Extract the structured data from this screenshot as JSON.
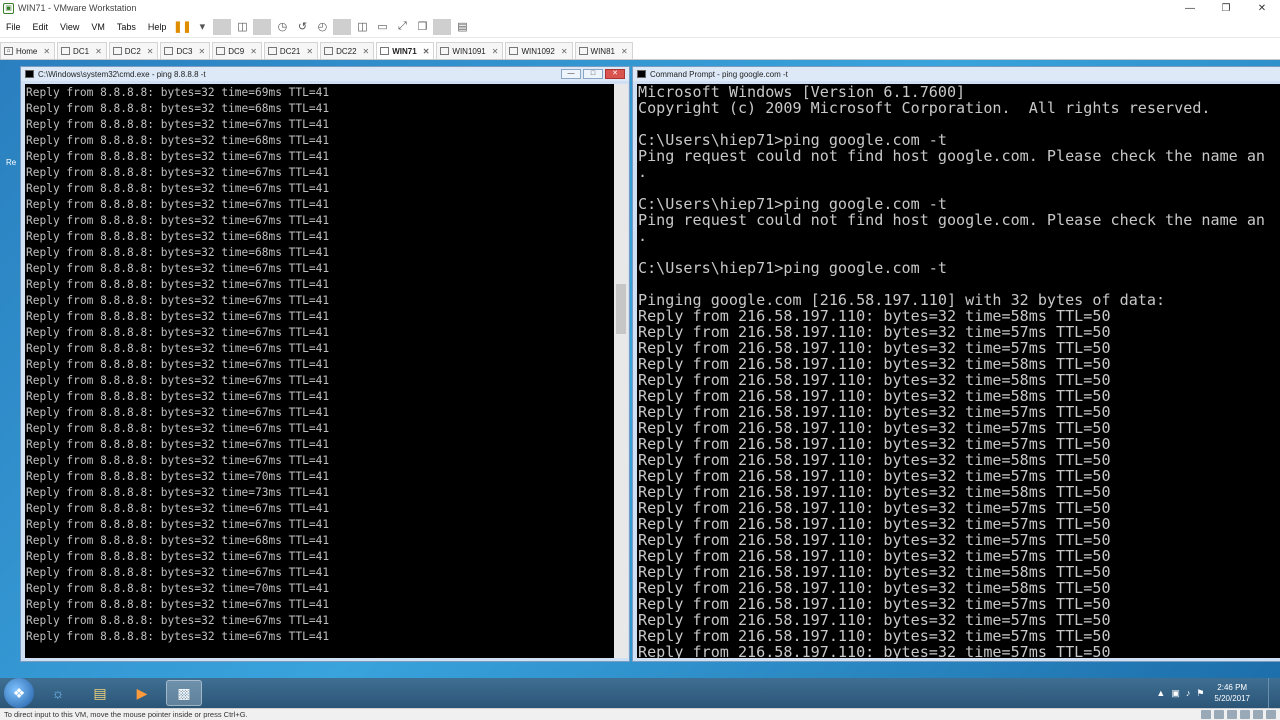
{
  "window": {
    "title": "WIN71 - VMware Workstation"
  },
  "menu": [
    "File",
    "Edit",
    "View",
    "VM",
    "Tabs",
    "Help"
  ],
  "tabs": [
    {
      "label": "Home",
      "active": false
    },
    {
      "label": "DC1",
      "active": false
    },
    {
      "label": "DC2",
      "active": false
    },
    {
      "label": "DC3",
      "active": false
    },
    {
      "label": "DC9",
      "active": false
    },
    {
      "label": "DC21",
      "active": false
    },
    {
      "label": "DC22",
      "active": false
    },
    {
      "label": "WIN71",
      "active": true
    },
    {
      "label": "WIN1091",
      "active": false
    },
    {
      "label": "WIN1092",
      "active": false
    },
    {
      "label": "WIN81",
      "active": false
    }
  ],
  "desktop": {
    "partial_text": "Re"
  },
  "cmd_left": {
    "title": "C:\\Windows\\system32\\cmd.exe - ping  8.8.8.8 -t",
    "lines": [
      "Reply from 8.8.8.8: bytes=32 time=69ms TTL=41",
      "Reply from 8.8.8.8: bytes=32 time=68ms TTL=41",
      "Reply from 8.8.8.8: bytes=32 time=67ms TTL=41",
      "Reply from 8.8.8.8: bytes=32 time=68ms TTL=41",
      "Reply from 8.8.8.8: bytes=32 time=67ms TTL=41",
      "Reply from 8.8.8.8: bytes=32 time=67ms TTL=41",
      "Reply from 8.8.8.8: bytes=32 time=67ms TTL=41",
      "Reply from 8.8.8.8: bytes=32 time=67ms TTL=41",
      "Reply from 8.8.8.8: bytes=32 time=67ms TTL=41",
      "Reply from 8.8.8.8: bytes=32 time=68ms TTL=41",
      "Reply from 8.8.8.8: bytes=32 time=68ms TTL=41",
      "Reply from 8.8.8.8: bytes=32 time=67ms TTL=41",
      "Reply from 8.8.8.8: bytes=32 time=67ms TTL=41",
      "Reply from 8.8.8.8: bytes=32 time=67ms TTL=41",
      "Reply from 8.8.8.8: bytes=32 time=67ms TTL=41",
      "Reply from 8.8.8.8: bytes=32 time=67ms TTL=41",
      "Reply from 8.8.8.8: bytes=32 time=67ms TTL=41",
      "Reply from 8.8.8.8: bytes=32 time=67ms TTL=41",
      "Reply from 8.8.8.8: bytes=32 time=67ms TTL=41",
      "Reply from 8.8.8.8: bytes=32 time=67ms TTL=41",
      "Reply from 8.8.8.8: bytes=32 time=67ms TTL=41",
      "Reply from 8.8.8.8: bytes=32 time=67ms TTL=41",
      "Reply from 8.8.8.8: bytes=32 time=67ms TTL=41",
      "Reply from 8.8.8.8: bytes=32 time=67ms TTL=41",
      "Reply from 8.8.8.8: bytes=32 time=70ms TTL=41",
      "Reply from 8.8.8.8: bytes=32 time=73ms TTL=41",
      "Reply from 8.8.8.8: bytes=32 time=67ms TTL=41",
      "Reply from 8.8.8.8: bytes=32 time=67ms TTL=41",
      "Reply from 8.8.8.8: bytes=32 time=68ms TTL=41",
      "Reply from 8.8.8.8: bytes=32 time=67ms TTL=41",
      "Reply from 8.8.8.8: bytes=32 time=67ms TTL=41",
      "Reply from 8.8.8.8: bytes=32 time=70ms TTL=41",
      "Reply from 8.8.8.8: bytes=32 time=67ms TTL=41",
      "Reply from 8.8.8.8: bytes=32 time=67ms TTL=41",
      "Reply from 8.8.8.8: bytes=32 time=67ms TTL=41"
    ]
  },
  "cmd_right": {
    "title": "Command Prompt - ping  google.com -t",
    "lines": [
      "Microsoft Windows [Version 6.1.7600]",
      "Copyright (c) 2009 Microsoft Corporation.  All rights reserved.",
      "",
      "C:\\Users\\hiep71>ping google.com -t",
      "Ping request could not find host google.com. Please check the name an",
      ".",
      "",
      "C:\\Users\\hiep71>ping google.com -t",
      "Ping request could not find host google.com. Please check the name an",
      ".",
      "",
      "C:\\Users\\hiep71>ping google.com -t",
      "",
      "Pinging google.com [216.58.197.110] with 32 bytes of data:",
      "Reply from 216.58.197.110: bytes=32 time=58ms TTL=50",
      "Reply from 216.58.197.110: bytes=32 time=57ms TTL=50",
      "Reply from 216.58.197.110: bytes=32 time=57ms TTL=50",
      "Reply from 216.58.197.110: bytes=32 time=58ms TTL=50",
      "Reply from 216.58.197.110: bytes=32 time=58ms TTL=50",
      "Reply from 216.58.197.110: bytes=32 time=58ms TTL=50",
      "Reply from 216.58.197.110: bytes=32 time=57ms TTL=50",
      "Reply from 216.58.197.110: bytes=32 time=57ms TTL=50",
      "Reply from 216.58.197.110: bytes=32 time=57ms TTL=50",
      "Reply from 216.58.197.110: bytes=32 time=58ms TTL=50",
      "Reply from 216.58.197.110: bytes=32 time=57ms TTL=50",
      "Reply from 216.58.197.110: bytes=32 time=58ms TTL=50",
      "Reply from 216.58.197.110: bytes=32 time=57ms TTL=50",
      "Reply from 216.58.197.110: bytes=32 time=57ms TTL=50",
      "Reply from 216.58.197.110: bytes=32 time=57ms TTL=50",
      "Reply from 216.58.197.110: bytes=32 time=57ms TTL=50",
      "Reply from 216.58.197.110: bytes=32 time=58ms TTL=50",
      "Reply from 216.58.197.110: bytes=32 time=58ms TTL=50",
      "Reply from 216.58.197.110: bytes=32 time=57ms TTL=50",
      "Reply from 216.58.197.110: bytes=32 time=57ms TTL=50",
      "Reply from 216.58.197.110: bytes=32 time=57ms TTL=50",
      "Reply from 216.58.197.110: bytes=32 time=57ms TTL=50"
    ]
  },
  "taskbar": {
    "clock_time": "2:46 PM",
    "clock_date": "5/20/2017"
  },
  "statusbar": {
    "text": "To direct input to this VM, move the mouse pointer inside or press Ctrl+G."
  },
  "colors": {
    "console_bg": "#000000",
    "console_fg": "#c0c0c0",
    "desktop": "#2a7fbf",
    "pause_icon": "#e08c00"
  }
}
